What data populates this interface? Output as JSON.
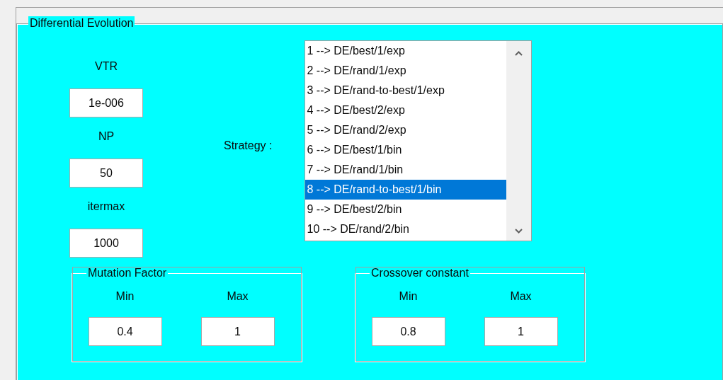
{
  "panel": {
    "title": "Differential Evolution"
  },
  "parameters": [
    {
      "label": "VTR",
      "value": "1e-006"
    },
    {
      "label": "NP",
      "value": "50"
    },
    {
      "label": "itermax",
      "value": "1000"
    }
  ],
  "strategy": {
    "label": "Strategy :",
    "options": [
      {
        "text": "1 --> DE/best/1/exp",
        "selected": false
      },
      {
        "text": "2 --> DE/rand/1/exp",
        "selected": false
      },
      {
        "text": "3 --> DE/rand-to-best/1/exp",
        "selected": false
      },
      {
        "text": "4 --> DE/best/2/exp",
        "selected": false
      },
      {
        "text": "5 --> DE/rand/2/exp",
        "selected": false
      },
      {
        "text": "6 --> DE/best/1/bin",
        "selected": false
      },
      {
        "text": "7 --> DE/rand/1/bin",
        "selected": false
      },
      {
        "text": "8 --> DE/rand-to-best/1/bin",
        "selected": true
      },
      {
        "text": "9 --> DE/best/2/bin",
        "selected": false
      },
      {
        "text": "10 --> DE/rand/2/bin",
        "selected": false
      }
    ]
  },
  "groups": [
    {
      "title": "Mutation Factor",
      "fields": [
        {
          "label": "Min",
          "value": "0.4"
        },
        {
          "label": "Max",
          "value": "1"
        }
      ]
    },
    {
      "title": "Crossover constant",
      "fields": [
        {
          "label": "Min",
          "value": "0.8"
        },
        {
          "label": "Max",
          "value": "1"
        }
      ]
    }
  ]
}
